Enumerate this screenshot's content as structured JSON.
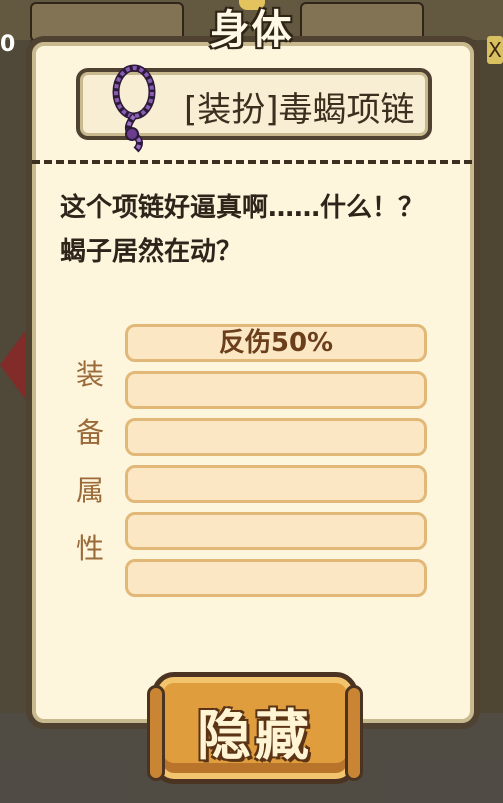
{
  "background": {
    "corner_number": "0",
    "close_glyph": "X"
  },
  "panel": {
    "title": "身体",
    "item": {
      "icon": "scorpion-necklace-icon",
      "name": "[装扮]毒蝎项链"
    },
    "description": "这个项链好逼真啊……什么！？蝎子居然在动？",
    "attributes": {
      "label_chars": [
        "装",
        "备",
        "属",
        "性"
      ],
      "slots": [
        "反伤50%",
        "",
        "",
        "",
        "",
        ""
      ]
    },
    "hide_button": "隐藏"
  },
  "colors": {
    "panel_bg": "#fdf6dd",
    "border": "#4f4230",
    "slot_bg": "#fbe7c3",
    "slot_border": "#e2b879",
    "label_color": "#9b6a3a",
    "button_bg": "#e09d3d"
  }
}
